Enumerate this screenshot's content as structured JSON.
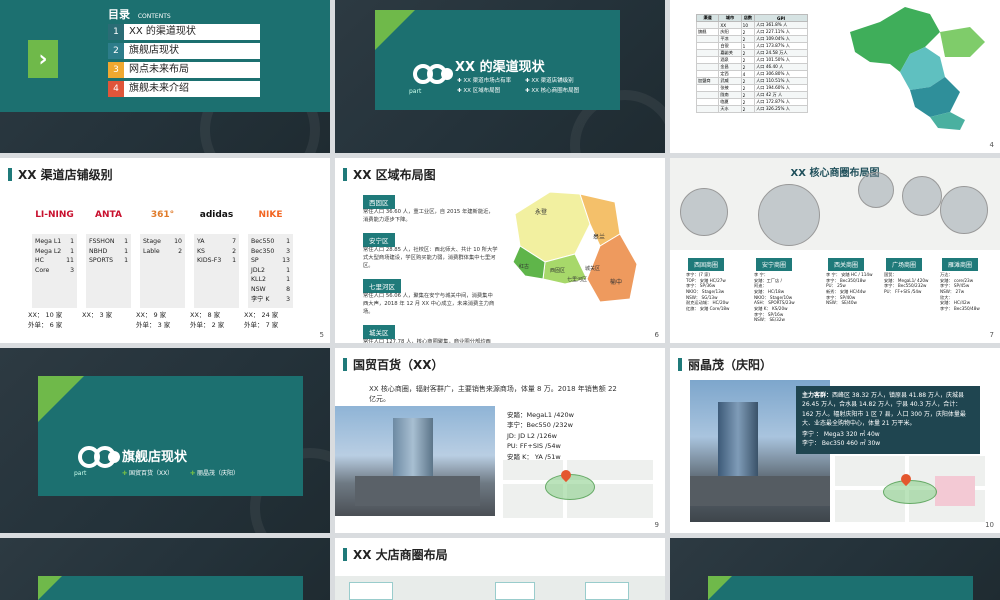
{
  "toc": {
    "title": "目录",
    "title_en": "CONTENTS",
    "items": [
      {
        "num": "1",
        "label": "XX 的渠道现状"
      },
      {
        "num": "2",
        "label": "旗舰店现状"
      },
      {
        "num": "3",
        "label": "网点未来布局"
      },
      {
        "num": "4",
        "label": "旗舰未来介绍"
      }
    ],
    "colors": [
      "#1f7a7a",
      "#2d7d8a",
      "#f0a830",
      "#e0553a"
    ]
  },
  "section1": {
    "title": "XX 的渠道现状",
    "part": "part",
    "bullets": [
      "XX 渠道市场占有率",
      "XX 渠道店铺级别",
      "XX 区域布局图",
      "XX 核心商圈布局图"
    ]
  },
  "slide4": {
    "page": "4",
    "headers": [
      "渠道",
      "城市",
      "店数",
      "GPI"
    ],
    "rows": [
      [
        "",
        "XX",
        "10",
        "人口 361.8% 人"
      ],
      [
        "",
        "庆阳",
        "2",
        "人口 227.11% 人"
      ],
      [
        "",
        "平凉",
        "2",
        "人口 109.04% 人"
      ],
      [
        "",
        "白银",
        "1",
        "人口 173.87% 人"
      ],
      [
        "",
        "嘉峪关",
        "2",
        "人口 24.58 万人"
      ],
      [
        "",
        "酒泉",
        "2",
        "人口 101.50% 人"
      ],
      [
        "",
        "金昌",
        "2",
        "人口 46.40 人"
      ],
      [
        "",
        "定西",
        "4",
        "人口 306.80% 人"
      ],
      [
        "",
        "武威",
        "2",
        "人口 110.51% 人"
      ],
      [
        "",
        "张掖",
        "2",
        "人口 194.60% 人"
      ],
      [
        "",
        "陇南",
        "2",
        "人口 42 万 人"
      ],
      [
        "",
        "临夏",
        "2",
        "人口 172.87% 人"
      ],
      [
        "",
        "天水",
        "2",
        "人口 326.25% 人"
      ]
    ],
    "group_labels": [
      "旗舰",
      "加盟商"
    ]
  },
  "slide5": {
    "title": "XX 渠道店铺级别",
    "page": "5",
    "brands": [
      {
        "logo": "LI-NING",
        "color": "#c8102e",
        "rows": [
          [
            "Mega L1",
            "1"
          ],
          [
            "Mega L2",
            "1"
          ],
          [
            "HC",
            "11"
          ],
          [
            "Core",
            "3"
          ]
        ],
        "summary": [
          "XX： 10 家",
          "外单： 6 家"
        ]
      },
      {
        "logo": "ANTA",
        "color": "#c8102e",
        "rows": [
          [
            "FSSHON",
            "1"
          ],
          [
            "NBHD",
            "1"
          ],
          [
            "SPORTS",
            "1"
          ]
        ],
        "summary": [
          "XX： 3 家"
        ]
      },
      {
        "logo": "361°",
        "color": "#e07b2a",
        "rows": [
          [
            "Stage",
            "10"
          ],
          [
            "Lable",
            "2"
          ]
        ],
        "summary": [
          "XX： 9 家",
          "外单： 3 家"
        ]
      },
      {
        "logo": "adidas",
        "color": "#111111",
        "rows": [
          [
            "YA",
            "7"
          ],
          [
            "KS",
            "2"
          ],
          [
            "KIDS-F3",
            "1"
          ]
        ],
        "summary": [
          "XX： 8 家",
          "外单： 2 家"
        ]
      },
      {
        "logo": "NIKE",
        "color": "#f26522",
        "rows": [
          [
            "Bec550",
            "1"
          ],
          [
            "Bec350",
            "3"
          ],
          [
            "SP",
            "13"
          ],
          [
            "JDL2",
            "1"
          ],
          [
            "KLL2",
            "1"
          ],
          [
            "NSW",
            "8"
          ],
          [
            "李宁 K",
            "3"
          ]
        ],
        "summary": [
          "XX： 24 家",
          "外单： 7 家"
        ]
      }
    ]
  },
  "slide6": {
    "title": "XX 区域布局图",
    "page": "6",
    "blocks": [
      {
        "tag": "西固区",
        "text": "常住人口 36.60 人，重工业区，自 2015 年建新能近，消费能力逐步下降。"
      },
      {
        "tag": "安宁区",
        "text": "常住人口 28.85 人，社校区：西北师大、共计 10 所大学式大型商场建设，学区购买能力弱，消费群体集中七里河区。"
      },
      {
        "tag": "七里河区",
        "text": "常住人口 56.06 人，聚集在安宁与城关中间，消费集中西大声，2018 年 12 月 XX 中心成立，未来消费主力商场。"
      },
      {
        "tag": "城关区",
        "text": "常住人口 127.78 人，核心商圈聚集，商业圈分部均西关、南关、广场、雁滩、东部商圈。销售主要来源于城关区。"
      }
    ],
    "map_labels": [
      "永登",
      "皋兰",
      "榆中",
      "西固区",
      "七里河区",
      "城关区",
      "红古"
    ]
  },
  "slide7": {
    "title": "XX 核心商圈布局图",
    "page": "7",
    "zones": [
      {
        "name": "西固商圈",
        "lines": [
          "李宁：(7 家)",
          "TOP： 安踏 HC/27w",
          "李宁： SP/36w",
          "NKIO： Stage/13w",
          "NSW： SG/13w",
          "耐克运动城： HC/20w",
          "红旗： 安踏 Core/18w"
        ]
      },
      {
        "name": "安宁商圈",
        "lines": [
          "李 宁：",
          "安踏：工厂店 /",
          "阿迪：",
          "安踏： HC/18w",
          "NKIO： Stage/10w",
          "ASH： SPORTS/23w",
          "安踏 K： KS/20w",
          "李宁： SP/16w",
          "NSW： SE/32w"
        ]
      },
      {
        "name": "西关商圈",
        "lines": [
          "李 宁： 安踏 HC / 114w",
          "李宁： Bec350/18w",
          "PU： 25w",
          "新秀： 安踏 HC/44w",
          "李宁： SP/40w",
          "NSW： SE/40w"
        ]
      },
      {
        "name": "广场商圈",
        "lines": [
          "国贸：",
          "安踏： MegaL1/ 420w",
          "李宁： Bec550/232w",
          "PU： FF+SIS /54w"
        ]
      },
      {
        "name": "雁滩商圈",
        "lines": [
          "万达：",
          "安踏： core/23w",
          "李宁： SP/45w",
          "NSW： 27w",
          "欣大：",
          "安踏： HC/42w",
          "李宁： Bec350/48w"
        ]
      }
    ]
  },
  "section2": {
    "title": "旗舰店现状",
    "part": "part",
    "bullets": [
      "国贸百货（XX）",
      "丽晶茂（庆阳）"
    ]
  },
  "slide9": {
    "title": "国贸百货（XX）",
    "page": "9",
    "intro": "XX 核心商圈，辐射客群广，主要销售来源商场，体量 8 万。2018 年销售额 22 亿元。",
    "stats": [
      "安踏：MegaL1 /420w",
      "李宁：Bec550 /232w",
      "JD: JD L2 /126w",
      "PU: FF+SIS /54w",
      "安踏 K： YA /51w"
    ]
  },
  "slide10": {
    "title": "丽晶茂（庆阳）",
    "page": "10",
    "info_title": "主力客群：",
    "info_text": "西峰区 38.32 万人，镇原县 41.88 万人，庆城县 26.45 万人，合水县 14.82 万人，宁县 40.3 万人，合计： 162 万人。辐射庆阳市 1 区 7 县，人口 300 万，庆阳体量最大、业态最全购物中心，体量 21 万平米。",
    "stats": [
      "李宁 ： Mega3 320 ㎡ 40w",
      "李宁： Bec350 460 ㎡ 30w"
    ]
  },
  "slide12": {
    "title": "XX 大店商圈布局"
  }
}
